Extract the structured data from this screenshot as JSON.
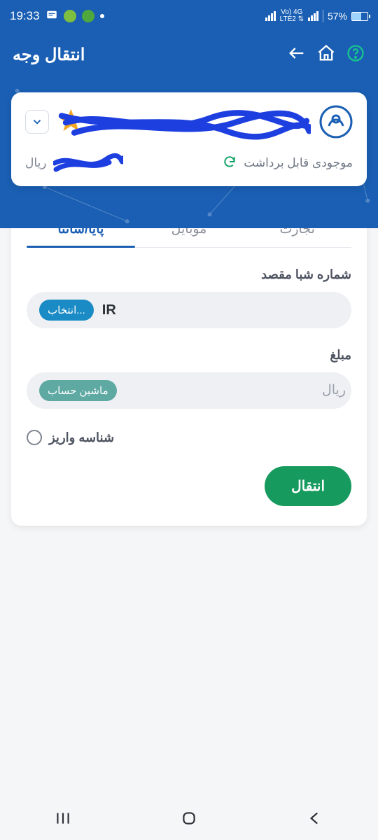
{
  "status": {
    "time": "19:33",
    "net_label": "Vo) 4G\nLTE2 ⇅",
    "battery_pct": "57%"
  },
  "header": {
    "title": "انتقال وجه"
  },
  "account_card": {
    "withdrawable_label": "موجودی قابل برداشت",
    "currency_suffix": "ریال"
  },
  "tabs": {
    "tejarat": "تجارت",
    "mobile": "موبایل",
    "paya_satna": "پایا/ساتنا",
    "active": "paya_satna"
  },
  "form": {
    "sheba_label": "شماره شبا مقصد",
    "sheba_prefix": "IR",
    "sheba_pill": "انتخاب...",
    "amount_label": "مبلغ",
    "amount_placeholder": "ریال",
    "amount_pill": "ماشین حساب",
    "deposit_id_label": "شناسه واریز",
    "submit_label": "انتقال"
  }
}
